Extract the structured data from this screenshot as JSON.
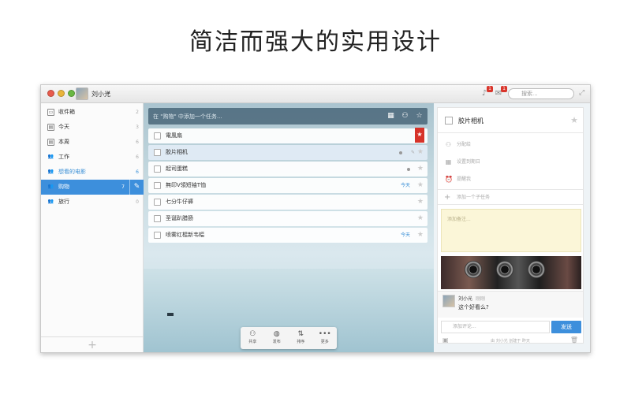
{
  "headline": "简洁而强大的实用设计",
  "titlebar": {
    "username": "刘小光",
    "caret": "▾",
    "notif_badge": "1",
    "chat_badge": "1",
    "search_placeholder": "搜索..."
  },
  "sidebar": {
    "items": [
      {
        "label": "收件箱",
        "count": "2",
        "icon": "inbox-icon"
      },
      {
        "label": "今天",
        "count": "3",
        "icon": "calendar-icon"
      },
      {
        "label": "本周",
        "count": "6",
        "icon": "calendar-week-icon"
      },
      {
        "label": "工作",
        "count": "6",
        "icon": "people-icon"
      },
      {
        "label": "想看的电影",
        "count": "6",
        "icon": "people-icon"
      },
      {
        "label": "购物",
        "count": "7",
        "icon": "people-icon"
      },
      {
        "label": "旅行",
        "count": "0",
        "icon": "people-icon"
      }
    ],
    "add_label": "+"
  },
  "main": {
    "add_placeholder": "在 \"购物\" 中添加一个任务...",
    "tasks": [
      {
        "title": "電風扇"
      },
      {
        "title": "胶片相机"
      },
      {
        "title": "起司蛋糕"
      },
      {
        "title": "無印V領短袖T恤",
        "due": "今天"
      },
      {
        "title": "七分牛仔褲"
      },
      {
        "title": "圣诞趴腊肠"
      },
      {
        "title": "喷雾红棍新韦幅",
        "due": "今天"
      }
    ],
    "toolbar": [
      {
        "label": "共享",
        "icon": "share-person-icon"
      },
      {
        "label": "发布",
        "icon": "globe-icon"
      },
      {
        "label": "排序",
        "icon": "sort-icon"
      },
      {
        "label": "更多",
        "icon": "more-icon"
      }
    ]
  },
  "detail": {
    "title": "胶片相机",
    "assign": "分配给",
    "due": "设置到期日",
    "remind": "提醒我",
    "subtask": "添加一个子任务",
    "note": "添加备注...",
    "comment": {
      "name": "刘小光",
      "time": "刚刚",
      "text": "这个好看么?"
    },
    "comment_placeholder": "添加评论...",
    "send": "发送",
    "footer": "由 刘小光 创建于 昨天"
  },
  "colors": {
    "accent": "#3d8fdc",
    "flag": "#d6332a"
  }
}
